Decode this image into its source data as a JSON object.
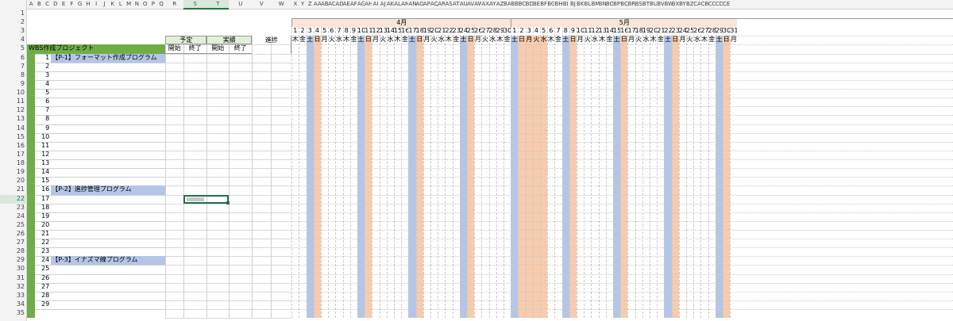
{
  "columns": [
    "A",
    "B",
    "C",
    "D",
    "E",
    "F",
    "G",
    "H",
    "I",
    "J",
    "K",
    "L",
    "M",
    "N",
    "O",
    "P",
    "Q",
    "R",
    "S",
    "T",
    "U",
    "V",
    "W",
    "X",
    "Y",
    "Z",
    "AA",
    "AB",
    "AC",
    "AD",
    "AE",
    "AF",
    "AG",
    "AH",
    "AI",
    "AJ",
    "AK",
    "AL",
    "AM",
    "AN",
    "AO",
    "AP",
    "AQ",
    "AR",
    "AS",
    "AT",
    "AU",
    "AV",
    "AW",
    "AX",
    "AY",
    "AZ",
    "BA",
    "BB",
    "BC",
    "BD",
    "BE",
    "BF",
    "BG",
    "BH",
    "BI",
    "BJ",
    "BK",
    "BL",
    "BM",
    "BN",
    "BO",
    "BP",
    "BQ",
    "BR",
    "BS",
    "BT",
    "BU",
    "BV",
    "BW",
    "BX",
    "BY",
    "BZ",
    "CA",
    "CB",
    "CC",
    "CD",
    "CE"
  ],
  "selected_columns": [
    "S",
    "T"
  ],
  "selected_row": "22",
  "row_numbers": [
    "1",
    "2",
    "3",
    "4",
    "5",
    "6",
    "7",
    "8",
    "9",
    "10",
    "11",
    "12",
    "13",
    "14",
    "15",
    "16",
    "17",
    "18",
    "19",
    "20",
    "21",
    "22",
    "23",
    "24",
    "25",
    "26",
    "27",
    "28",
    "29",
    "30",
    "31",
    "32",
    "33",
    "34",
    "35"
  ],
  "project_title": "WBS作成プロジェクト",
  "headers": {
    "plan": "予定",
    "actual": "実績",
    "progress": "進捗",
    "start": "開始",
    "end": "終了"
  },
  "task_numbers": [
    "1",
    "2",
    "3",
    "4",
    "5",
    "6",
    "7",
    "8",
    "9",
    "10",
    "11",
    "12",
    "13",
    "14",
    "15",
    "16",
    "17",
    "18",
    "19",
    "20",
    "21",
    "22",
    "23",
    "24",
    "25",
    "26",
    "27",
    "28",
    "29"
  ],
  "tasks": [
    {
      "row": 6,
      "label": "【P-1】フォーマット作成プログラム"
    },
    {
      "row": 21,
      "label": "【P-2】進捗管理プログラム"
    },
    {
      "row": 29,
      "label": "【P-3】イナズマ線プログラム"
    }
  ],
  "months": [
    {
      "label": "4月",
      "days": 30
    },
    {
      "label": "5月",
      "days": 31
    }
  ],
  "april_weekdays": [
    "木",
    "金",
    "土",
    "日",
    "月",
    "火",
    "水",
    "木",
    "金",
    "土",
    "日",
    "月",
    "火",
    "水",
    "木",
    "金",
    "土",
    "日",
    "月",
    "火",
    "水",
    "木",
    "金",
    "土",
    "日",
    "月",
    "火",
    "水",
    "木",
    "金"
  ],
  "may_weekdays": [
    "土",
    "日",
    "月",
    "火",
    "水",
    "木",
    "金",
    "土",
    "日",
    "月",
    "火",
    "水",
    "木",
    "金",
    "土",
    "日",
    "月",
    "火",
    "水",
    "木",
    "金",
    "土",
    "日",
    "月",
    "火",
    "水",
    "木",
    "金",
    "土",
    "日",
    "月"
  ],
  "colors": {
    "project_green": "#70ad47",
    "task_blue": "#b4c6e7",
    "saturday_blue": "#b4c6e7",
    "sunday_orange": "#f8cbad",
    "month_header": "#fce4d6",
    "plan_header": "#e2efda",
    "selection": "#217346"
  }
}
